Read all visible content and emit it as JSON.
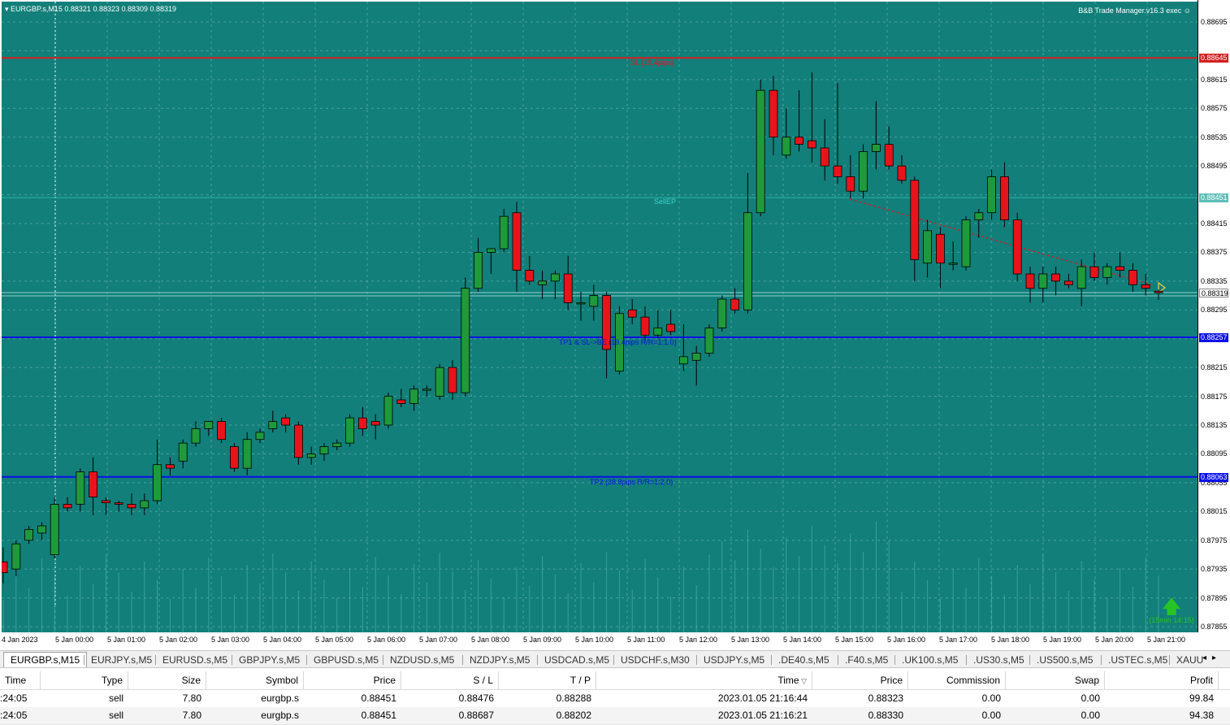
{
  "chart": {
    "header": "EURGBP.s,M15  0.88321 0.88323 0.88309 0.88319",
    "header_arrow_icon": "triangle-down-icon",
    "ea_label": "B&B Trade Manager.v16.3 exec",
    "ea_icon": "smiley-icon",
    "colors": {
      "background": "#127F7A",
      "grid": "#5DAAA5",
      "bull": "#1F9A3A",
      "bear": "#E8141B",
      "sl_line": "#D42020",
      "tp_line": "#0A10E8"
    },
    "levels": {
      "sl": {
        "price": 0.88645,
        "label": "SL (19.4pips)",
        "axis": "0.88645"
      },
      "entry": {
        "price": 0.88451,
        "label": "SellEP",
        "axis": "0.88451"
      },
      "tp1": {
        "price": 0.88257,
        "label": "TP1 & SL->BE (19.4pips R/R=1:1.0)",
        "axis": "0.88257"
      },
      "tp2": {
        "price": 0.88063,
        "label": "TP2 (38.8pips R/R=1:2.0)",
        "axis": "0.88063"
      },
      "current": {
        "price": 0.88319,
        "axis": "0.88319"
      }
    },
    "price_ticks": [
      "0.88695",
      "0.88615",
      "0.88575",
      "0.88535",
      "0.88495",
      "0.88415",
      "0.88375",
      "0.88335",
      "0.88295",
      "0.88215",
      "0.88175",
      "0.88135",
      "0.88095",
      "0.88055",
      "0.88015",
      "0.87975",
      "0.87935",
      "0.87895",
      "0.87855"
    ],
    "time_labels": [
      "4 Jan 2023",
      "5 Jan 00:00",
      "5 Jan 01:00",
      "5 Jan 02:00",
      "5 Jan 03:00",
      "5 Jan 04:00",
      "5 Jan 05:00",
      "5 Jan 06:00",
      "5 Jan 07:00",
      "5 Jan 08:00",
      "5 Jan 09:00",
      "5 Jan 10:00",
      "5 Jan 11:00",
      "5 Jan 12:00",
      "5 Jan 13:00",
      "5 Jan 14:00",
      "5 Jan 15:00",
      "5 Jan 16:00",
      "5 Jan 17:00",
      "5 Jan 18:00",
      "5 Jan 19:00",
      "5 Jan 20:00",
      "5 Jan 21:00"
    ],
    "timer_label": "(15min 14:15)",
    "timer_icon": "up-arrow-icon"
  },
  "chart_data": {
    "type": "candlestick",
    "symbol": "EURGBP.s",
    "timeframe": "M15",
    "ohlc": [
      [
        0.87945,
        0.87965,
        0.87915,
        0.8793
      ],
      [
        0.87935,
        0.87975,
        0.87925,
        0.8797
      ],
      [
        0.87975,
        0.87995,
        0.8797,
        0.8799
      ],
      [
        0.87985,
        0.88,
        0.87975,
        0.87995
      ],
      [
        0.87955,
        0.88035,
        0.8795,
        0.88025
      ],
      [
        0.88025,
        0.88035,
        0.88015,
        0.8802
      ],
      [
        0.88025,
        0.88075,
        0.88015,
        0.8807
      ],
      [
        0.8807,
        0.8809,
        0.8801,
        0.88035
      ],
      [
        0.8803,
        0.88035,
        0.8801,
        0.88027
      ],
      [
        0.88027,
        0.8803,
        0.88015,
        0.88025
      ],
      [
        0.88025,
        0.8804,
        0.8801,
        0.8802
      ],
      [
        0.8802,
        0.8804,
        0.8801,
        0.8803
      ],
      [
        0.8803,
        0.88115,
        0.88025,
        0.8808
      ],
      [
        0.8808,
        0.8809,
        0.88065,
        0.88075
      ],
      [
        0.88085,
        0.88115,
        0.88075,
        0.8811
      ],
      [
        0.8811,
        0.8814,
        0.88105,
        0.8813
      ],
      [
        0.8813,
        0.8814,
        0.8812,
        0.8814
      ],
      [
        0.8814,
        0.88145,
        0.8811,
        0.88115
      ],
      [
        0.88105,
        0.8811,
        0.8807,
        0.88075
      ],
      [
        0.88075,
        0.88125,
        0.88065,
        0.88115
      ],
      [
        0.88115,
        0.8813,
        0.8811,
        0.88125
      ],
      [
        0.8813,
        0.88155,
        0.88125,
        0.8814
      ],
      [
        0.88145,
        0.8815,
        0.88125,
        0.88135
      ],
      [
        0.88135,
        0.8814,
        0.8808,
        0.8809
      ],
      [
        0.8809,
        0.88105,
        0.8808,
        0.88095
      ],
      [
        0.88095,
        0.8811,
        0.88085,
        0.88105
      ],
      [
        0.88105,
        0.88115,
        0.881,
        0.8811
      ],
      [
        0.8811,
        0.8815,
        0.88105,
        0.88145
      ],
      [
        0.88145,
        0.8816,
        0.8812,
        0.8813
      ],
      [
        0.8814,
        0.8815,
        0.88115,
        0.88135
      ],
      [
        0.88135,
        0.8818,
        0.8813,
        0.88175
      ],
      [
        0.8817,
        0.88185,
        0.8816,
        0.88165
      ],
      [
        0.88165,
        0.8819,
        0.88155,
        0.88185
      ],
      [
        0.88185,
        0.8819,
        0.88175,
        0.88185
      ],
      [
        0.88175,
        0.8822,
        0.8817,
        0.88215
      ],
      [
        0.88215,
        0.88225,
        0.8817,
        0.8818
      ],
      [
        0.8818,
        0.8834,
        0.88175,
        0.88325
      ],
      [
        0.88325,
        0.88395,
        0.8832,
        0.88375
      ],
      [
        0.88375,
        0.8838,
        0.88345,
        0.8838
      ],
      [
        0.8838,
        0.88435,
        0.88375,
        0.88425
      ],
      [
        0.8843,
        0.88445,
        0.8832,
        0.8835
      ],
      [
        0.8835,
        0.8837,
        0.8833,
        0.88335
      ],
      [
        0.8833,
        0.8835,
        0.8831,
        0.88335
      ],
      [
        0.88335,
        0.8835,
        0.8831,
        0.88345
      ],
      [
        0.88345,
        0.8837,
        0.88295,
        0.88305
      ],
      [
        0.88305,
        0.8832,
        0.8828,
        0.88305
      ],
      [
        0.883,
        0.8833,
        0.8828,
        0.88315
      ],
      [
        0.88315,
        0.8832,
        0.882,
        0.8824
      ],
      [
        0.8821,
        0.883,
        0.88205,
        0.8829
      ],
      [
        0.88295,
        0.8831,
        0.88275,
        0.88285
      ],
      [
        0.88285,
        0.883,
        0.8825,
        0.8826
      ],
      [
        0.8826,
        0.88295,
        0.88255,
        0.8827
      ],
      [
        0.88275,
        0.88295,
        0.8826,
        0.88265
      ],
      [
        0.8822,
        0.88275,
        0.8821,
        0.8823
      ],
      [
        0.88225,
        0.88245,
        0.8819,
        0.88235
      ],
      [
        0.88235,
        0.88275,
        0.8823,
        0.8827
      ],
      [
        0.8827,
        0.88315,
        0.88265,
        0.8831
      ],
      [
        0.8831,
        0.88325,
        0.8829,
        0.88295
      ],
      [
        0.88295,
        0.88485,
        0.8829,
        0.8843
      ],
      [
        0.8843,
        0.88615,
        0.88425,
        0.886
      ],
      [
        0.886,
        0.8862,
        0.8851,
        0.88535
      ],
      [
        0.8851,
        0.88575,
        0.88505,
        0.88535
      ],
      [
        0.88535,
        0.886,
        0.88515,
        0.88525
      ],
      [
        0.8853,
        0.88625,
        0.885,
        0.8852
      ],
      [
        0.8852,
        0.8856,
        0.88475,
        0.88495
      ],
      [
        0.88495,
        0.8861,
        0.8847,
        0.8848
      ],
      [
        0.8848,
        0.8851,
        0.8845,
        0.8846
      ],
      [
        0.8846,
        0.88525,
        0.8845,
        0.88515
      ],
      [
        0.88515,
        0.88585,
        0.8849,
        0.88525
      ],
      [
        0.88525,
        0.8855,
        0.8849,
        0.88495
      ],
      [
        0.88495,
        0.8851,
        0.8847,
        0.88475
      ],
      [
        0.88475,
        0.8848,
        0.88335,
        0.88365
      ],
      [
        0.8836,
        0.8842,
        0.8834,
        0.88405
      ],
      [
        0.884,
        0.8841,
        0.88325,
        0.8836
      ],
      [
        0.8836,
        0.8839,
        0.8835,
        0.8836
      ],
      [
        0.88355,
        0.88425,
        0.8835,
        0.8842
      ],
      [
        0.8842,
        0.88435,
        0.88395,
        0.8843
      ],
      [
        0.8843,
        0.8849,
        0.8842,
        0.8848
      ],
      [
        0.8848,
        0.885,
        0.8841,
        0.8842
      ],
      [
        0.8842,
        0.8843,
        0.88335,
        0.88345
      ],
      [
        0.88345,
        0.88355,
        0.88305,
        0.88325
      ],
      [
        0.88325,
        0.88355,
        0.88305,
        0.88345
      ],
      [
        0.88345,
        0.88355,
        0.88315,
        0.88335
      ],
      [
        0.88335,
        0.88345,
        0.88325,
        0.8833
      ],
      [
        0.88325,
        0.88365,
        0.883,
        0.88355
      ],
      [
        0.88355,
        0.88375,
        0.88335,
        0.8834
      ],
      [
        0.8834,
        0.8836,
        0.8833,
        0.88355
      ],
      [
        0.88355,
        0.88375,
        0.8834,
        0.8835
      ],
      [
        0.8835,
        0.8836,
        0.8832,
        0.8833
      ],
      [
        0.8833,
        0.88345,
        0.88315,
        0.88325
      ],
      [
        0.88321,
        0.88323,
        0.88309,
        0.88319
      ]
    ],
    "ylim": [
      0.87855,
      0.88715
    ]
  },
  "tabs": [
    "EURGBP.s,M15",
    "EURJPY.s,M5",
    "EURUSD.s,M5",
    "GBPJPY.s,M5",
    "GBPUSD.s,M5",
    "NZDUSD.s,M5",
    "NZDJPY.s,M5",
    "USDCAD.s,M5",
    "USDCHF.s,M30",
    "USDJPY.s,M5",
    ".DE40.s,M5",
    ".F40.s,M5",
    ".UK100.s,M5",
    ".US30.s,M5",
    ".US500.s,M5",
    ".USTEC.s,M5",
    "XAUU"
  ],
  "tab_arrows": {
    "left": "◂",
    "right": "▸"
  },
  "table": {
    "headers": [
      "Time",
      "Type",
      "Size",
      "Symbol",
      "Price",
      "S / L",
      "T / P",
      "Time",
      "Price",
      "Commission",
      "Swap",
      "Profit"
    ],
    "sort_icon": "▽",
    "rows": [
      [
        ":24:05",
        "sell",
        "7.80",
        "eurgbp.s",
        "0.88451",
        "0.88476",
        "0.88288",
        "2023.01.05 21:16:44",
        "0.88323",
        "0.00",
        "0.00",
        "99.84"
      ],
      [
        ":24:05",
        "sell",
        "7.80",
        "eurgbp.s",
        "0.88451",
        "0.88687",
        "0.88202",
        "2023.01.05 21:16:21",
        "0.88330",
        "0.00",
        "0.00",
        "94.38"
      ]
    ]
  }
}
